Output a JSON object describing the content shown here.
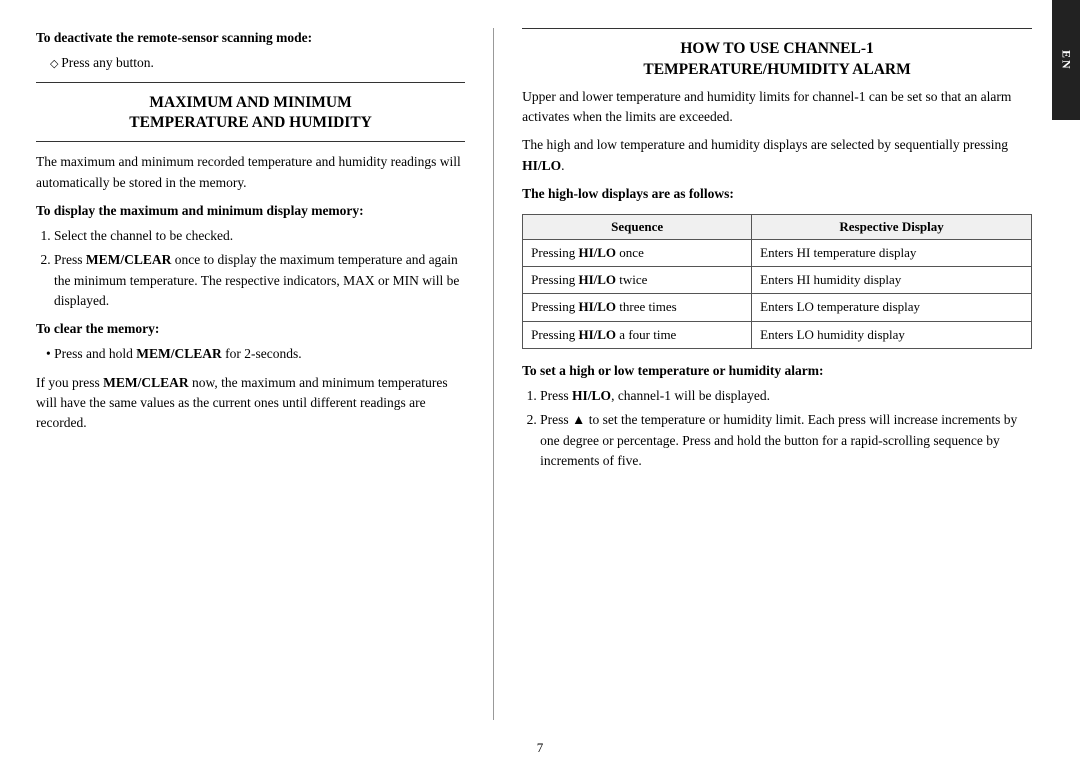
{
  "en_tab": "EN",
  "left": {
    "deactivate_heading": "To deactivate the remote-sensor scanning mode:",
    "deactivate_item": "Press any button.",
    "section1_title_line1": "Maximum and Minimum",
    "section1_title_line2": "Temperature and Humidity",
    "section1_intro": "The maximum and minimum recorded temperature and humidity readings will automatically be stored in the memory.",
    "display_heading": "To display the maximum and minimum display memory:",
    "step1": "Select the channel to be checked.",
    "step2": "Press MEM/CLEAR once to display the maximum temperature and again the minimum temperature. The respective indicators, MAX or MIN will be displayed.",
    "clear_heading": "To clear the memory:",
    "clear_bullet": "Press and hold MEM/CLEAR for 2-seconds.",
    "clear_para": "If you press MEM/CLEAR now, the maximum and minimum temperatures will have the same values as the current ones until different readings are recorded."
  },
  "right": {
    "section2_title_line1": "How to Use Channel-1",
    "section2_title_line2": "Temperature/Humidity Alarm",
    "intro_para1": "Upper and lower temperature and humidity limits for channel-1 can be set so that an alarm activates when the limits are exceeded.",
    "intro_para2": "The high and low temperature and humidity displays are selected by sequentially pressing HI/LO.",
    "table_heading": "The high-low displays are as follows:",
    "table": {
      "headers": [
        "Sequence",
        "Respective Display"
      ],
      "rows": [
        [
          "Pressing HI/LO once",
          "Enters HI temperature display"
        ],
        [
          "Pressing HI/LO twice",
          "Enters HI humidity display"
        ],
        [
          "Pressing HI/LO three times",
          "Enters LO temperature display"
        ],
        [
          "Pressing HI/LO a four time",
          "Enters LO humidity display"
        ]
      ]
    },
    "alarm_heading": "To set a high or low temperature or humidity alarm:",
    "alarm_step1": "Press HI/LO, channel-1 will be displayed.",
    "alarm_step2": "Press ▲ to set the temperature or humidity limit. Each press will increase increments by one degree or percentage. Press and hold the button for a rapid-scrolling sequence by increments of five."
  },
  "page_number": "7"
}
